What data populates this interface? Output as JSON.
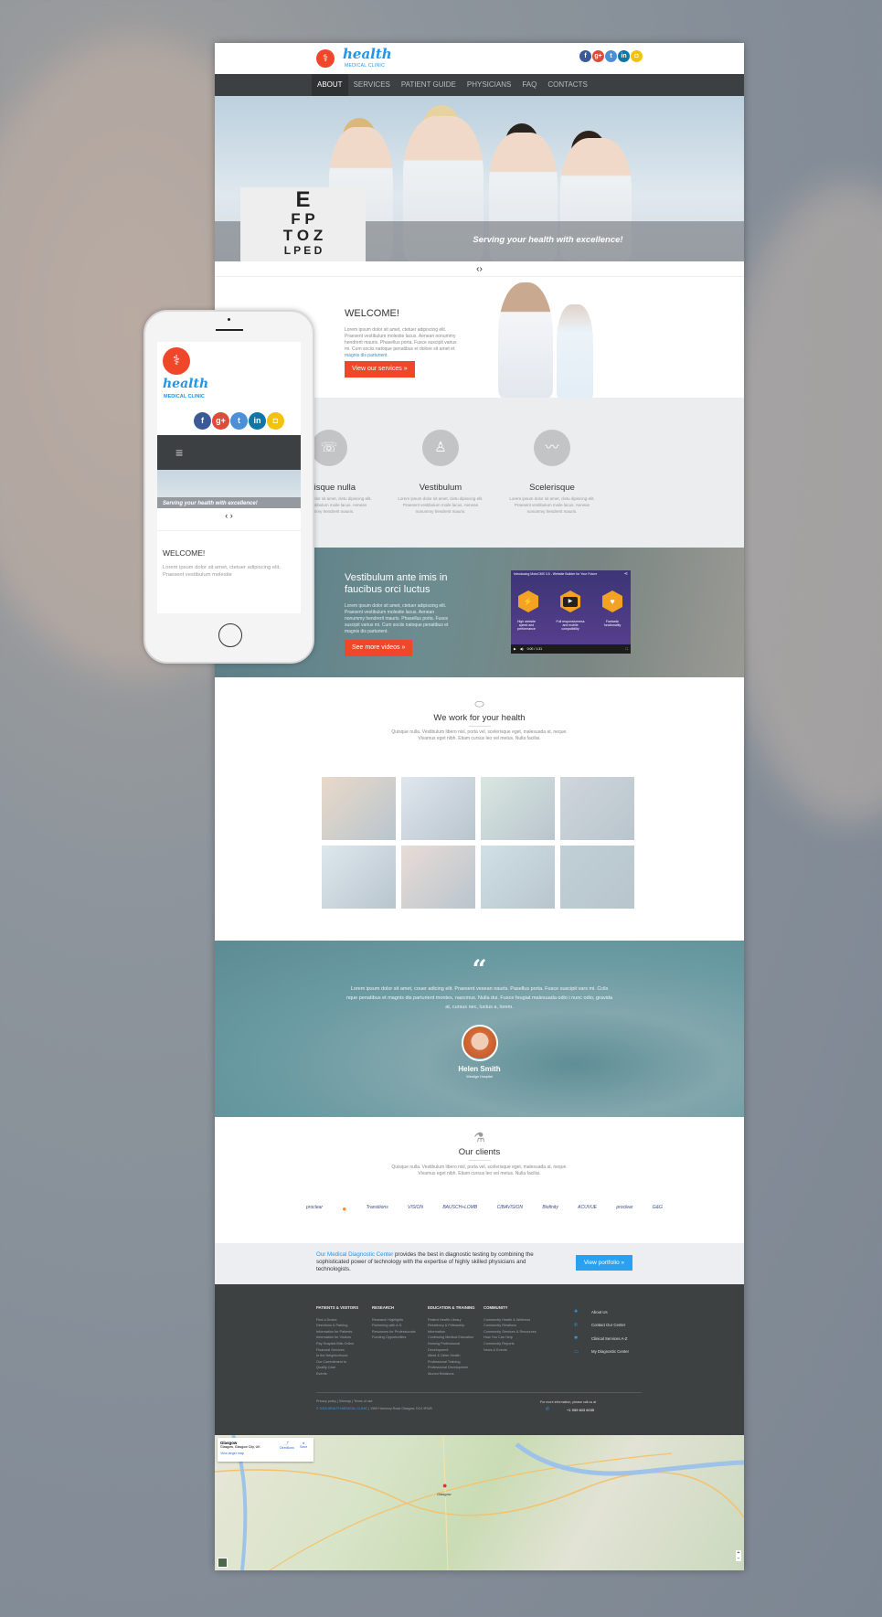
{
  "colors": {
    "accent": "#f0472b",
    "brand_blue": "#2196e8",
    "nav_bg": "#3d4042",
    "footer_bg": "#3e4142",
    "cta_blue": "#2aa1f0"
  },
  "header": {
    "logo_word": "health",
    "logo_sub": "MEDICAL CLINIC",
    "logo_icon": "caduceus-icon",
    "social": [
      {
        "name": "facebook",
        "glyph": "f",
        "color": "#3b5998"
      },
      {
        "name": "google-plus",
        "glyph": "g+",
        "color": "#dd4b39"
      },
      {
        "name": "twitter",
        "glyph": "t",
        "color": "#4a90d9"
      },
      {
        "name": "linkedin",
        "glyph": "in",
        "color": "#0e76a8"
      },
      {
        "name": "instagram",
        "glyph": "◘",
        "color": "#f4c20d"
      }
    ]
  },
  "nav": {
    "items": [
      "ABOUT",
      "SERVICES",
      "PATIENT GUIDE",
      "PHYSICIANS",
      "FAQ",
      "CONTACTS"
    ],
    "active": "ABOUT"
  },
  "hero": {
    "caption": "Serving your health with excellence!",
    "chart_rows": [
      "E",
      "F P",
      "T O Z",
      "L P E D"
    ],
    "arrows": "‹›"
  },
  "welcome": {
    "title": "WELCOME!",
    "text": "Lorem ipsum dolor sit amet, ctetuer adipiscing elit. Praesent vestibulum molestie lacus. Aenean nonummy hendrerit mauris. Phasellus porta. Fusce suscipit varius mi. Cum sociis natoque penatibus et dolore sit amet et",
    "link": "magnis dis parturient.",
    "button": "View our services"
  },
  "features": [
    {
      "icon": "phone-24-icon",
      "glyph": "☏",
      "title": "Quisque nulla",
      "text": "Lorem ipsum dolor sit amet, cletu dipiscing elit. Praesent vestibulum moile lacus. Aenean nonummy hendrerit mauris."
    },
    {
      "icon": "nurse-icon",
      "glyph": "♙",
      "title": "Vestibulum",
      "text": "Lorem ipsum dolor sit amet, cletu dipiscing elit. Praesent vestibulum moile lacus. Aenean nonummy hendrerit mauris."
    },
    {
      "icon": "heartbeat-icon",
      "glyph": "〰",
      "title": "Scelerisque",
      "text": "Lorem ipsum dolor sit amet, cletu dipiscing elit. Praesent vestibulum moile lacus. Aenean nonummy hendrerit mauris."
    }
  ],
  "videos": {
    "title": "Vestibulum ante imis in faucibus orci luctus",
    "text": "Lorem ipsum dolor sit amet, ctetuer adipiscing elit. Praesent vestibulum molestie lacus. Aenean nonummy hendrerit mauris. Phasellus porta. Fusce suscipit varius mi. Cum sociis natoque penatibus et magnis dis parturient.",
    "button": "See more videos",
    "player": {
      "title": "Introducing MotoCMS 3.5 - Website Builder for Your Future",
      "features": [
        "High website speed and performance",
        "Full responsiveness and mobile compatibility",
        "Fantastic functionality"
      ],
      "time": "0:00 / 1:31",
      "progress": 0
    }
  },
  "work": {
    "icon": "pill-icon",
    "title": "We work for your health",
    "text": "Quisque nulla. Vestibulum libero nisl, porta vel, scelerisque eget, malesuada at, neque. Vivamus eget nibh. Etiam cursus leo vel metus. Nulla facilisi."
  },
  "testimonial": {
    "quote_icon": "“",
    "text": "Lorem ipsum dolor sit amet, couer adicing elit. Praesent vesean nauris. Pasellus porta. Fusce suscipit vars mi. Ccils nque penatibus et magnis dis parturient montes, nascmus. Nulla dui. Fusce feugiat malesuada odio i nunc odio, gravida at, cursus nec, luctus a, lorem.",
    "name": "Helen Smith",
    "role": "Westign Hospital"
  },
  "clients": {
    "icon": "microscope-icon",
    "title": "Our clients",
    "text": "Quisque nulla. Vestibulum libero nisl, porta vel, scelerisque eget, malesuada at, neque. Vivamus eget nibh. Etiam cursus leo vel metus. Nulla facilisi.",
    "logos": [
      "proclear",
      "●",
      "Transitions",
      "VISION",
      "BAUSCH+LOMB",
      "CIBAVISION",
      "Biofinity",
      "ACUVUE",
      "proclear",
      "G&G"
    ]
  },
  "diagnostic": {
    "link": "Our Medical Diagnostic Center",
    "text": " provides the best in diagnostic testing by combining the sophisticated power of technology with the expertise of highly skilled physicians and technologists.",
    "button": "View portfolio »"
  },
  "footer": {
    "columns": [
      {
        "title": "PATIENTS & VISITORS",
        "items": [
          "Find a Doctor",
          "Directions & Parking",
          "Information for Patients",
          "Information for Visitors",
          "Pay Hospital Bills Online",
          "Financial Services",
          "In the Neighborhood",
          "Our Commitment to",
          "Quality Care",
          "Events"
        ]
      },
      {
        "title": "RESEARCH",
        "items": [
          "Research Highlights",
          "Partnering with A.S.",
          "Resources for Professionals",
          "Funding Opportunities"
        ]
      },
      {
        "title": "EDUCATION & TRAINING",
        "items": [
          "Patient Health Library",
          "Residency & Fellowship",
          "Information",
          "Continuing Medical Education",
          "Nursing Professional",
          "Development",
          "Allied & Other Health",
          "Professional Training",
          "Professional Development",
          "Alumni Relations"
        ]
      },
      {
        "title": "COMMUNITY",
        "items": [
          "Community Health & Wellness",
          "Community Relations",
          "Community Services & Resources",
          "How You Can Help",
          "Community Reports",
          "News & Events"
        ]
      }
    ],
    "quick_links": [
      {
        "icon": "plus-square-icon",
        "glyph": "✚",
        "label": "About Us"
      },
      {
        "icon": "phone-icon",
        "glyph": "✆",
        "label": "Contact Our Center"
      },
      {
        "icon": "asterisk-icon",
        "glyph": "✱",
        "label": "Clinical Services A-Z"
      },
      {
        "icon": "laptop-icon",
        "glyph": "▭",
        "label": "My Diagnostic Center"
      }
    ],
    "legal": "Privacy policy  |  Sitemap  |  Terms of use",
    "copyright": "© 2015 HEALTH MEDICAL CLINIC",
    "address": " | 1965 Harmony Road Glasgow, DC4 9RUB",
    "call_label": "For more information, please call us at",
    "phone": "+1 959 603 6035"
  },
  "map": {
    "place": "Glasgow",
    "address": "Glasgow, Glasgow City, UK",
    "larger": "View larger map",
    "directions": "Directions",
    "save": "Save",
    "city_label": "Glasgow"
  },
  "mobile": {
    "logo_word": "health",
    "logo_sub": "MEDICAL CLINIC",
    "caption": "Serving your health with excellence!",
    "arrows": "‹ ›",
    "welcome": "WELCOME!",
    "text": "Lorem ipsum dolor sit amet, ctetuer adipiscing elit. Praesent vestibulum molestie"
  }
}
